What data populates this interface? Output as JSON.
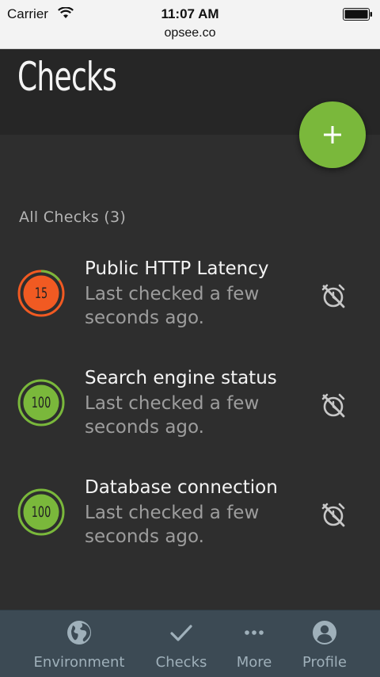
{
  "status_bar": {
    "carrier": "Carrier",
    "time": "11:07 AM"
  },
  "browser": {
    "url": "opsee.co"
  },
  "header": {
    "title": "Checks"
  },
  "colors": {
    "accent_green": "#7ab83b",
    "warning_orange": "#f15a22",
    "tab_bar": "#3c4a54"
  },
  "section": {
    "label": "All Checks (3)"
  },
  "checks": [
    {
      "name": "Public HTTP Latency",
      "status": "Last checked a few seconds ago.",
      "health": "15",
      "health_fraction": 0.15,
      "color": "#f15a22",
      "icon": "alarm-off-icon"
    },
    {
      "name": "Search engine status",
      "status": "Last checked a few seconds ago.",
      "health": "100",
      "health_fraction": 1.0,
      "color": "#7ab83b",
      "icon": "alarm-off-icon"
    },
    {
      "name": "Database connection",
      "status": "Last checked a few seconds ago.",
      "health": "100",
      "health_fraction": 1.0,
      "color": "#7ab83b",
      "icon": "alarm-off-icon"
    }
  ],
  "tabs": [
    {
      "label": "Environment",
      "icon": "globe-icon"
    },
    {
      "label": "Checks",
      "icon": "checkmark-icon"
    },
    {
      "label": "More",
      "icon": "more-dots-icon"
    },
    {
      "label": "Profile",
      "icon": "profile-icon"
    }
  ]
}
